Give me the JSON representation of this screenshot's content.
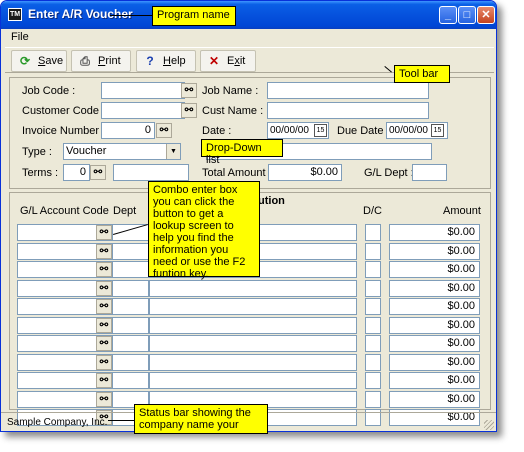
{
  "window": {
    "title": "Enter A/R Voucher",
    "min": "_",
    "max": "□",
    "close": "✕"
  },
  "menu": {
    "file": "File"
  },
  "toolbar": {
    "save": {
      "prefix": "",
      "accel": "S",
      "rest": "ave",
      "icon": "refresh-icon"
    },
    "print": {
      "prefix": "",
      "accel": "P",
      "rest": "rint",
      "icon": "printer-icon"
    },
    "help": {
      "prefix": "",
      "accel": "H",
      "rest": "elp",
      "icon": "question-icon"
    },
    "exit": {
      "prefix": "E",
      "accel": "x",
      "rest": "it",
      "icon": "x-icon"
    }
  },
  "form": {
    "job_code_label": "Job Code :",
    "customer_code_label": "Customer Code :",
    "invoice_number_label": "Invoice Number :",
    "invoice_number_value": "0",
    "type_label": "Type :",
    "type_value": "Voucher",
    "terms_label": "Terms :",
    "terms_value": "0",
    "job_name_label": "Job Name :",
    "cust_name_label": "Cust Name :",
    "date_label": "Date :",
    "date_value": "00/00/00",
    "due_date_label": "Due Date :",
    "due_date_value": "00/00/00",
    "total_amount_label": "Total Amount :",
    "total_amount_value": "$0.00",
    "gl_dept_label": "G/L Dept :"
  },
  "grid": {
    "headers": {
      "account": "G/L Account Code",
      "dept": "Dept",
      "description": "ution",
      "dc": "D/C",
      "amount": "Amount"
    },
    "rows": [
      "$0.00",
      "$0.00",
      "$0.00",
      "$0.00",
      "$0.00",
      "$0.00",
      "$0.00",
      "$0.00",
      "$0.00",
      "$0.00",
      "$0.00"
    ]
  },
  "status": {
    "company": "Sample Company, Inc."
  },
  "callouts": {
    "program_name": "Program name",
    "tool_bar": "Tool bar",
    "dropdown_list": "Drop-Down list",
    "combo": "Combo enter box you can click the button to get a lookup screen to help you find the information you need or use the F2 funtion key.",
    "status_bar": "Status bar showing the company name your"
  },
  "colors": {
    "callout": "#ffff00",
    "titlebar": "#0550dc"
  }
}
